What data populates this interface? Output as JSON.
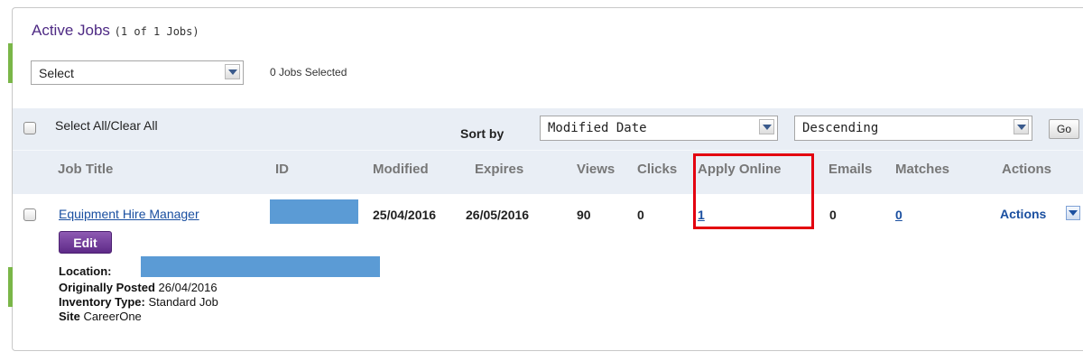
{
  "header": {
    "title": "Active Jobs",
    "count_text": "(1 of 1 Jobs)",
    "bulk_select_value": "Select",
    "jobs_selected_text": "0 Jobs Selected"
  },
  "toolbar": {
    "select_all_label": "Select All/Clear All",
    "sort_by_label": "Sort by",
    "sort_field_value": "Modified Date",
    "sort_order_value": "Descending",
    "go_label": "Go"
  },
  "table": {
    "columns": [
      "Job Title",
      "ID",
      "Modified",
      "Expires",
      "Views",
      "Clicks",
      "Apply Online",
      "Emails",
      "Matches",
      "Actions"
    ],
    "rows": [
      {
        "job_title": "Equipment Hire Manager",
        "modified": "25/04/2016",
        "expires": "26/05/2016",
        "views": "90",
        "clicks": "0",
        "apply_online": "1",
        "emails": "0",
        "matches": "0",
        "actions_label": "Actions",
        "edit_label": "Edit",
        "location_label": "Location:",
        "originally_posted_label": "Originally Posted",
        "originally_posted_value": "26/04/2016",
        "inventory_type_label": "Inventory Type:",
        "inventory_type_value": "Standard Job",
        "site_label": "Site",
        "site_value": "CareerOne"
      }
    ]
  },
  "colors": {
    "title_purple": "#4e2a84",
    "link_blue": "#1a4fa0",
    "highlight_red": "#e3000f",
    "redaction_blue": "#5b9bd5",
    "toolbar_bg": "#e9eef5",
    "side_mark_green": "#7ab648"
  },
  "icons": {
    "dropdown": "chevron-down-icon"
  }
}
